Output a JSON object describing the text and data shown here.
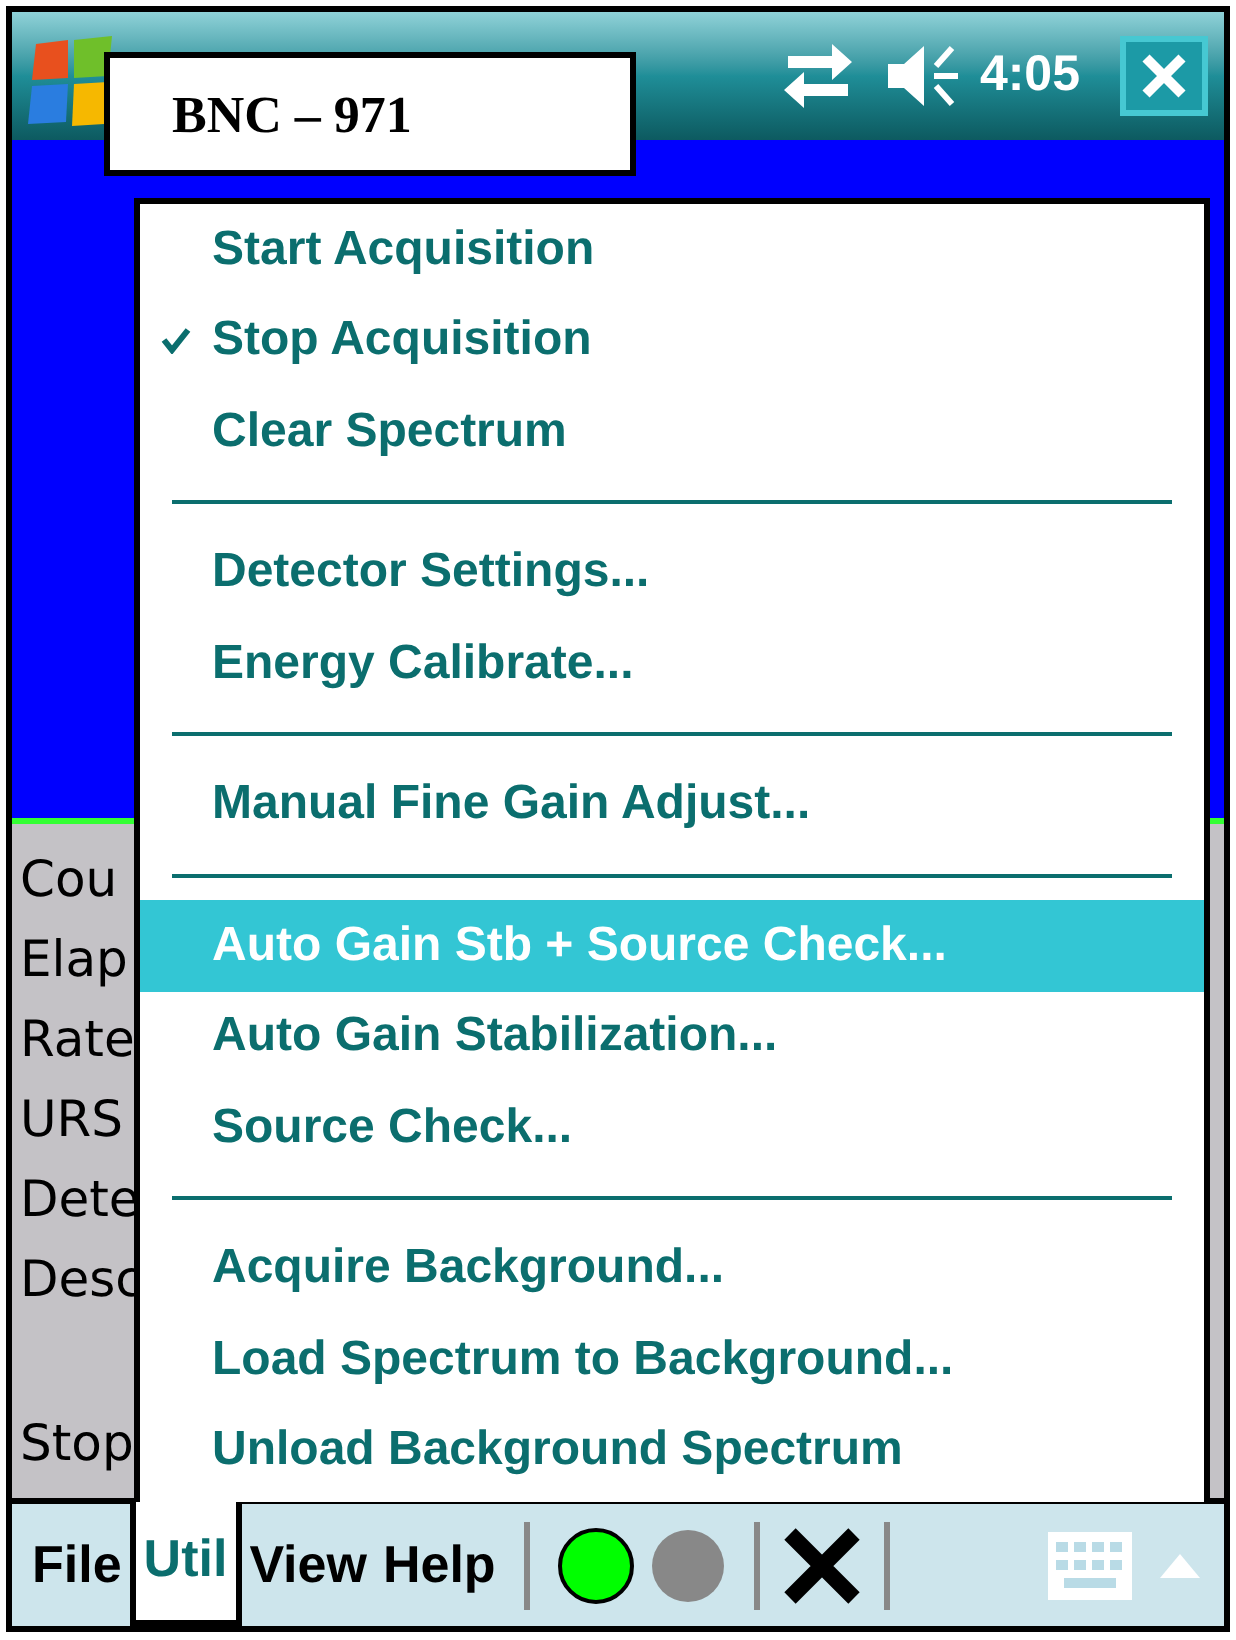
{
  "status_bar": {
    "time": "4:05"
  },
  "app_title": "BNC – 971",
  "readouts": [
    "Cou",
    "Elap",
    "Rate",
    "URS",
    "Dete",
    "Desc"
  ],
  "footer_readout": "Stop",
  "menu": {
    "items": [
      {
        "kind": "item",
        "label": "Start Acquisition",
        "checked": false,
        "selected": false
      },
      {
        "kind": "item",
        "label": "Stop Acquisition",
        "checked": true,
        "selected": false
      },
      {
        "kind": "item",
        "label": "Clear Spectrum",
        "checked": false,
        "selected": false
      },
      {
        "kind": "separator"
      },
      {
        "kind": "item",
        "label": "Detector Settings...",
        "checked": false,
        "selected": false
      },
      {
        "kind": "item",
        "label": "Energy Calibrate...",
        "checked": false,
        "selected": false
      },
      {
        "kind": "separator"
      },
      {
        "kind": "item",
        "label": "Manual Fine Gain Adjust...",
        "checked": false,
        "selected": false
      },
      {
        "kind": "separator"
      },
      {
        "kind": "item",
        "label": "Auto Gain Stb + Source Check...",
        "checked": false,
        "selected": true
      },
      {
        "kind": "item",
        "label": "Auto Gain Stabilization...",
        "checked": false,
        "selected": false
      },
      {
        "kind": "item",
        "label": "Source Check...",
        "checked": false,
        "selected": false
      },
      {
        "kind": "separator"
      },
      {
        "kind": "item",
        "label": "Acquire Background...",
        "checked": false,
        "selected": false
      },
      {
        "kind": "item",
        "label": "Load Spectrum to Background...",
        "checked": false,
        "selected": false
      },
      {
        "kind": "item",
        "label": "Unload Background Spectrum",
        "checked": false,
        "selected": false
      }
    ]
  },
  "menu_bar": {
    "items": [
      {
        "label": "File",
        "selected": false
      },
      {
        "label": "Util",
        "selected": true
      },
      {
        "label": "View",
        "selected": false
      },
      {
        "label": "Help",
        "selected": false
      }
    ]
  },
  "toolbar": [
    {
      "kind": "light",
      "color": "#00ff00"
    },
    {
      "kind": "light",
      "color": "#888888"
    },
    {
      "kind": "close"
    }
  ]
}
